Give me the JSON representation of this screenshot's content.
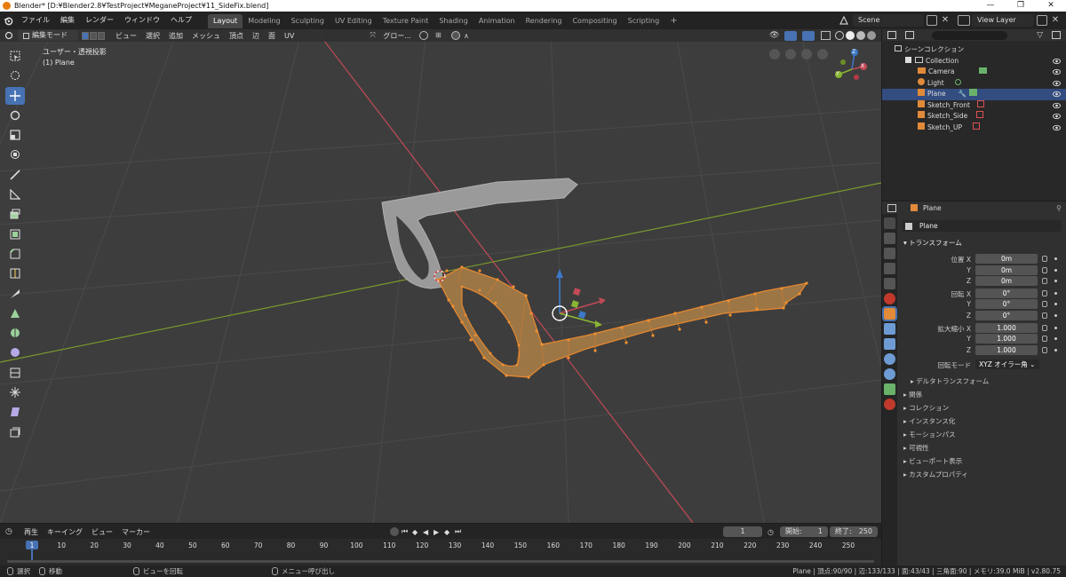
{
  "window": {
    "title": "Blender* [D:¥Blender2.8¥TestProject¥MeganeProject¥11_SideFix.blend]",
    "minimize": "—",
    "maximize": "❐",
    "close": "✕"
  },
  "menu": [
    "ファイル",
    "編集",
    "レンダー",
    "ウィンドウ",
    "ヘルプ"
  ],
  "workspaces": [
    {
      "label": "Layout",
      "active": true
    },
    {
      "label": "Modeling"
    },
    {
      "label": "Sculpting"
    },
    {
      "label": "UV Editing"
    },
    {
      "label": "Texture Paint"
    },
    {
      "label": "Shading"
    },
    {
      "label": "Animation"
    },
    {
      "label": "Rendering"
    },
    {
      "label": "Compositing"
    },
    {
      "label": "Scripting"
    }
  ],
  "add_workspace": "+",
  "scene": {
    "value": "Scene"
  },
  "view_layer": {
    "value": "View Layer"
  },
  "viewport": {
    "mode": "編集モード",
    "menus": [
      "ビュー",
      "選択",
      "追加",
      "メッシュ",
      "頂点",
      "辺",
      "面",
      "UV"
    ],
    "transform_orientation": "グロー...",
    "view_name": "ユーザー・透視投影",
    "object_name": "(1) Plane",
    "gizmo_axes": {
      "x": "X",
      "y": "Y",
      "z": "Z"
    }
  },
  "outliner": {
    "title": "シーンコレクション",
    "rows": [
      {
        "label": "Collection",
        "level": 1
      },
      {
        "label": "Camera",
        "level": 2
      },
      {
        "label": "Light",
        "level": 2
      },
      {
        "label": "Plane",
        "level": 2,
        "selected": true
      },
      {
        "label": "Sketch_Front",
        "level": 2
      },
      {
        "label": "Sketch_Side",
        "level": 2
      },
      {
        "label": "Sketch_UP",
        "level": 2
      }
    ]
  },
  "properties": {
    "object_header": "Plane",
    "object_name": "Plane",
    "transform_title": "トランスフォーム",
    "location": {
      "label": "位置 X",
      "y": "Y",
      "z": "Z",
      "values": [
        "0m",
        "0m",
        "0m"
      ]
    },
    "rotation": {
      "label": "回転 X",
      "y": "Y",
      "z": "Z",
      "values": [
        "0°",
        "0°",
        "0°"
      ]
    },
    "scale": {
      "label": "拡大縮小 X",
      "y": "Y",
      "z": "Z",
      "values": [
        "1.000",
        "1.000",
        "1.000"
      ]
    },
    "rotation_mode": {
      "label": "回転モード",
      "value": "XYZ オイラー角"
    },
    "delta": "デルタトランスフォーム",
    "panels": [
      "関係",
      "コレクション",
      "インスタンス化",
      "モーションパス",
      "可視性",
      "ビューポート表示",
      "カスタムプロパティ"
    ]
  },
  "timeline": {
    "menus": [
      "再生",
      "キーイング",
      "ビュー",
      "マーカー"
    ],
    "current_frame": "1",
    "start": {
      "label": "開始:",
      "value": "1"
    },
    "end": {
      "label": "終了:",
      "value": "250"
    },
    "ticks": [
      "1",
      "10",
      "20",
      "30",
      "40",
      "50",
      "60",
      "70",
      "80",
      "90",
      "100",
      "110",
      "120",
      "130",
      "140",
      "150",
      "160",
      "170",
      "180",
      "190",
      "200",
      "210",
      "220",
      "230",
      "240",
      "250"
    ]
  },
  "statusbar": {
    "select": "選択",
    "move": "移動",
    "rotate_view": "ビューを回転",
    "call_menu": "メニュー呼び出し",
    "stats": "Plane | 頂点:90/90 | 辺:133/133 | 面:43/43 | 三角面:90 | メモリ:39.0 MiB | v2.80.75"
  },
  "colors": {
    "accent": "#4772b3",
    "selection": "#e8892e",
    "x_axis": "#c24a57",
    "y_axis": "#7a9a2c",
    "z_axis": "#3c78c8"
  }
}
